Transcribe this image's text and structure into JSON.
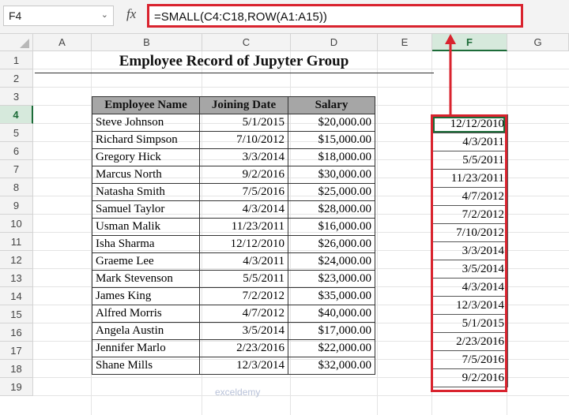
{
  "formula_bar": {
    "name_box": "F4",
    "fx_label": "fx",
    "formula": "=SMALL(C4:C18,ROW(A1:A15))"
  },
  "columns": [
    "A",
    "B",
    "C",
    "D",
    "E",
    "F",
    "G"
  ],
  "selected_column": "F",
  "rows": [
    "1",
    "2",
    "3",
    "4",
    "5",
    "6",
    "7",
    "8",
    "9",
    "10",
    "11",
    "12",
    "13",
    "14",
    "15",
    "16",
    "17",
    "18",
    "19"
  ],
  "selected_row": "4",
  "sheet": {
    "title": "Employee Record of Jupyter Group",
    "headers": [
      "Employee Name",
      "Joining Date",
      "Salary"
    ],
    "employees": [
      {
        "name": "Steve Johnson",
        "date": "5/1/2015",
        "salary": "$20,000.00"
      },
      {
        "name": "Richard Simpson",
        "date": "7/10/2012",
        "salary": "$15,000.00"
      },
      {
        "name": "Gregory Hick",
        "date": "3/3/2014",
        "salary": "$18,000.00"
      },
      {
        "name": "Marcus North",
        "date": "9/2/2016",
        "salary": "$30,000.00"
      },
      {
        "name": "Natasha Smith",
        "date": "7/5/2016",
        "salary": "$25,000.00"
      },
      {
        "name": "Samuel Taylor",
        "date": "4/3/2014",
        "salary": "$28,000.00"
      },
      {
        "name": "Usman Malik",
        "date": "11/23/2011",
        "salary": "$16,000.00"
      },
      {
        "name": "Isha Sharma",
        "date": "12/12/2010",
        "salary": "$26,000.00"
      },
      {
        "name": "Graeme Lee",
        "date": "4/3/2011",
        "salary": "$24,000.00"
      },
      {
        "name": "Mark Stevenson",
        "date": "5/5/2011",
        "salary": "$23,000.00"
      },
      {
        "name": "James King",
        "date": "7/2/2012",
        "salary": "$35,000.00"
      },
      {
        "name": "Alfred Morris",
        "date": "4/7/2012",
        "salary": "$40,000.00"
      },
      {
        "name": "Angela Austin",
        "date": "3/5/2014",
        "salary": "$17,000.00"
      },
      {
        "name": "Jennifer Marlo",
        "date": "2/23/2016",
        "salary": "$22,000.00"
      },
      {
        "name": "Shane Mills",
        "date": "12/3/2014",
        "salary": "$32,000.00"
      }
    ],
    "sorted_dates": [
      "12/12/2010",
      "4/3/2011",
      "5/5/2011",
      "11/23/2011",
      "4/7/2012",
      "7/2/2012",
      "7/10/2012",
      "3/3/2014",
      "3/5/2014",
      "4/3/2014",
      "12/3/2014",
      "5/1/2015",
      "2/23/2016",
      "7/5/2016",
      "9/2/2016"
    ]
  },
  "watermark": "exceldemy",
  "colors": {
    "highlight": "#d9232e",
    "selection": "#1c6b38",
    "header_fill": "#a6a6a6"
  }
}
